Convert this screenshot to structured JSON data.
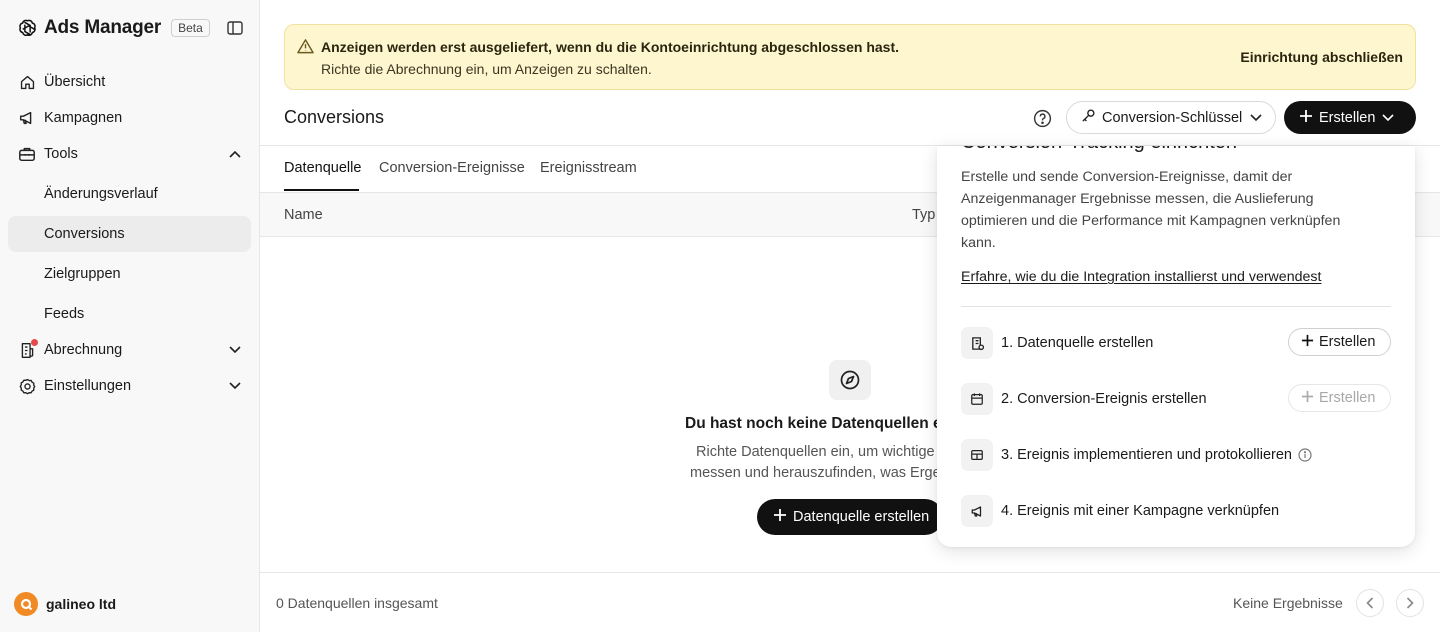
{
  "sidebar": {
    "brand": "Ads Manager",
    "badge": "Beta",
    "items": {
      "overview": "Übersicht",
      "campaigns": "Kampagnen",
      "tools": "Tools",
      "change_history": "Änderungsverlauf",
      "conversions": "Conversions",
      "audiences": "Zielgruppen",
      "feeds": "Feeds",
      "billing": "Abrechnung",
      "settings": "Einstellungen"
    },
    "account": "galineo ltd"
  },
  "banner": {
    "title": "Anzeigen werden erst ausgeliefert, wenn du die Kontoeinrichtung abgeschlossen hast.",
    "subtitle": "Richte die Abrechnung ein, um Anzeigen zu schalten.",
    "cta": "Einrichtung abschließen"
  },
  "header": {
    "title": "Conversions",
    "key_button": "Conversion-Schlüssel",
    "create_button": "Erstellen"
  },
  "tabs": [
    "Datenquelle",
    "Conversion-Ereignisse",
    "Ereignisstream"
  ],
  "table": {
    "col_name": "Name",
    "col_type": "Typ"
  },
  "empty_state": {
    "title": "Du hast noch keine Datenquellen e",
    "desc_line1": "Richte Datenquellen ein, um wichtige A",
    "desc_line2": "messen und herauszufinden, was Ergeb",
    "button": "Datenquelle erstellen"
  },
  "footer": {
    "count": "0 Datenquellen insgesamt",
    "no_results": "Keine Ergebnisse"
  },
  "popover": {
    "title": "Conversion-Tracking einrichten",
    "description": "Erstelle und sende Conversion-Ereignisse, damit der Anzeigenmanager Ergebnisse messen, die Auslieferung optimieren und die Performance mit Kampagnen verknüpfen kann.",
    "link": "Erfahre, wie du die Integration installierst und verwendest",
    "steps": [
      {
        "label": "1. Datenquelle erstellen",
        "button": "Erstellen"
      },
      {
        "label": "2. Conversion-Ereignis erstellen",
        "button": "Erstellen"
      },
      {
        "label": "3. Ereignis implementieren und protokollieren"
      },
      {
        "label": "4. Ereignis mit einer Kampagne verknüpfen"
      }
    ]
  },
  "colors": {
    "banner_bg": "#fdf6cf",
    "primary_button": "#111111",
    "notification_dot": "#e5484d",
    "avatar": "#f08a24"
  }
}
